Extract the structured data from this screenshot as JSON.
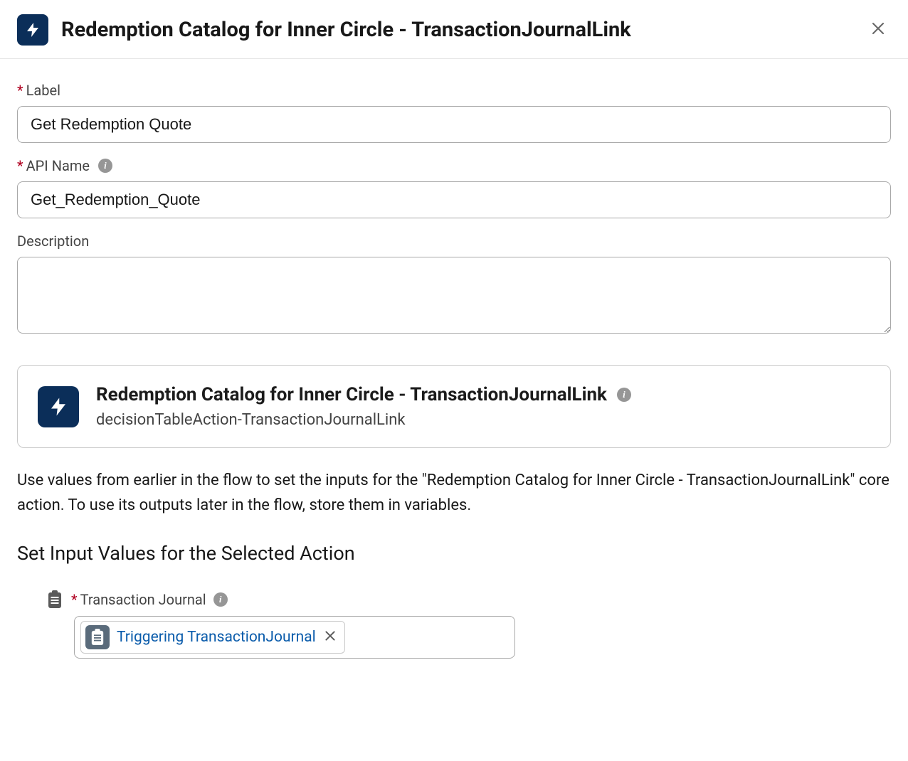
{
  "header": {
    "title": "Redemption Catalog for Inner Circle - TransactionJournalLink"
  },
  "fields": {
    "label": {
      "label": "Label",
      "value": "Get Redemption Quote"
    },
    "apiName": {
      "label": "API Name",
      "value": "Get_Redemption_Quote"
    },
    "description": {
      "label": "Description",
      "value": ""
    }
  },
  "actionCard": {
    "title": "Redemption Catalog for Inner Circle - TransactionJournalLink",
    "subtitle": "decisionTableAction-TransactionJournalLink"
  },
  "helperText": "Use values from earlier in the flow to set the inputs for the \"Redemption Catalog for Inner Circle - TransactionJournalLink\" core action. To use its outputs later in the flow, store them in variables.",
  "sectionHeading": "Set Input Values for the Selected Action",
  "inputValues": {
    "transactionJournal": {
      "label": "Transaction Journal",
      "pill": {
        "label": "Triggering TransactionJournal"
      }
    }
  }
}
